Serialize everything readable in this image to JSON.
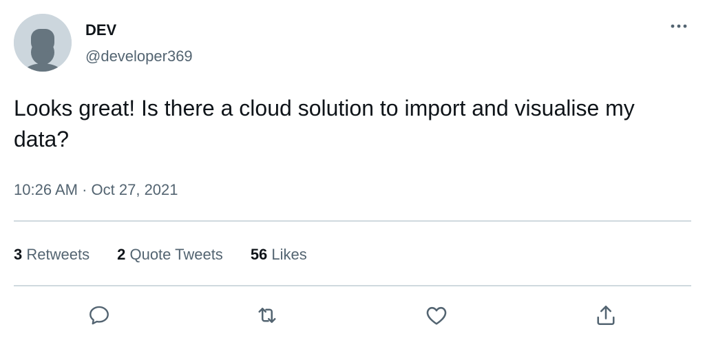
{
  "tweet": {
    "display_name": "DEV",
    "handle": "@developer369",
    "text": "Looks great! Is there a cloud solution to import and visualise my data?",
    "time": "10:26 AM",
    "separator": "·",
    "date": "Oct 27, 2021"
  },
  "stats": {
    "retweets_count": "3",
    "retweets_label": "Retweets",
    "quotes_count": "2",
    "quotes_label": "Quote Tweets",
    "likes_count": "56",
    "likes_label": "Likes"
  },
  "icons": {
    "more": "more-horizontal-icon",
    "reply": "reply-icon",
    "retweet": "retweet-icon",
    "like": "heart-icon",
    "share": "share-icon"
  },
  "colors": {
    "text": "#0f1419",
    "secondary": "#536471",
    "divider": "#cfd9de",
    "avatar_bg": "#ccd6dd",
    "avatar_fg": "#66757f"
  }
}
